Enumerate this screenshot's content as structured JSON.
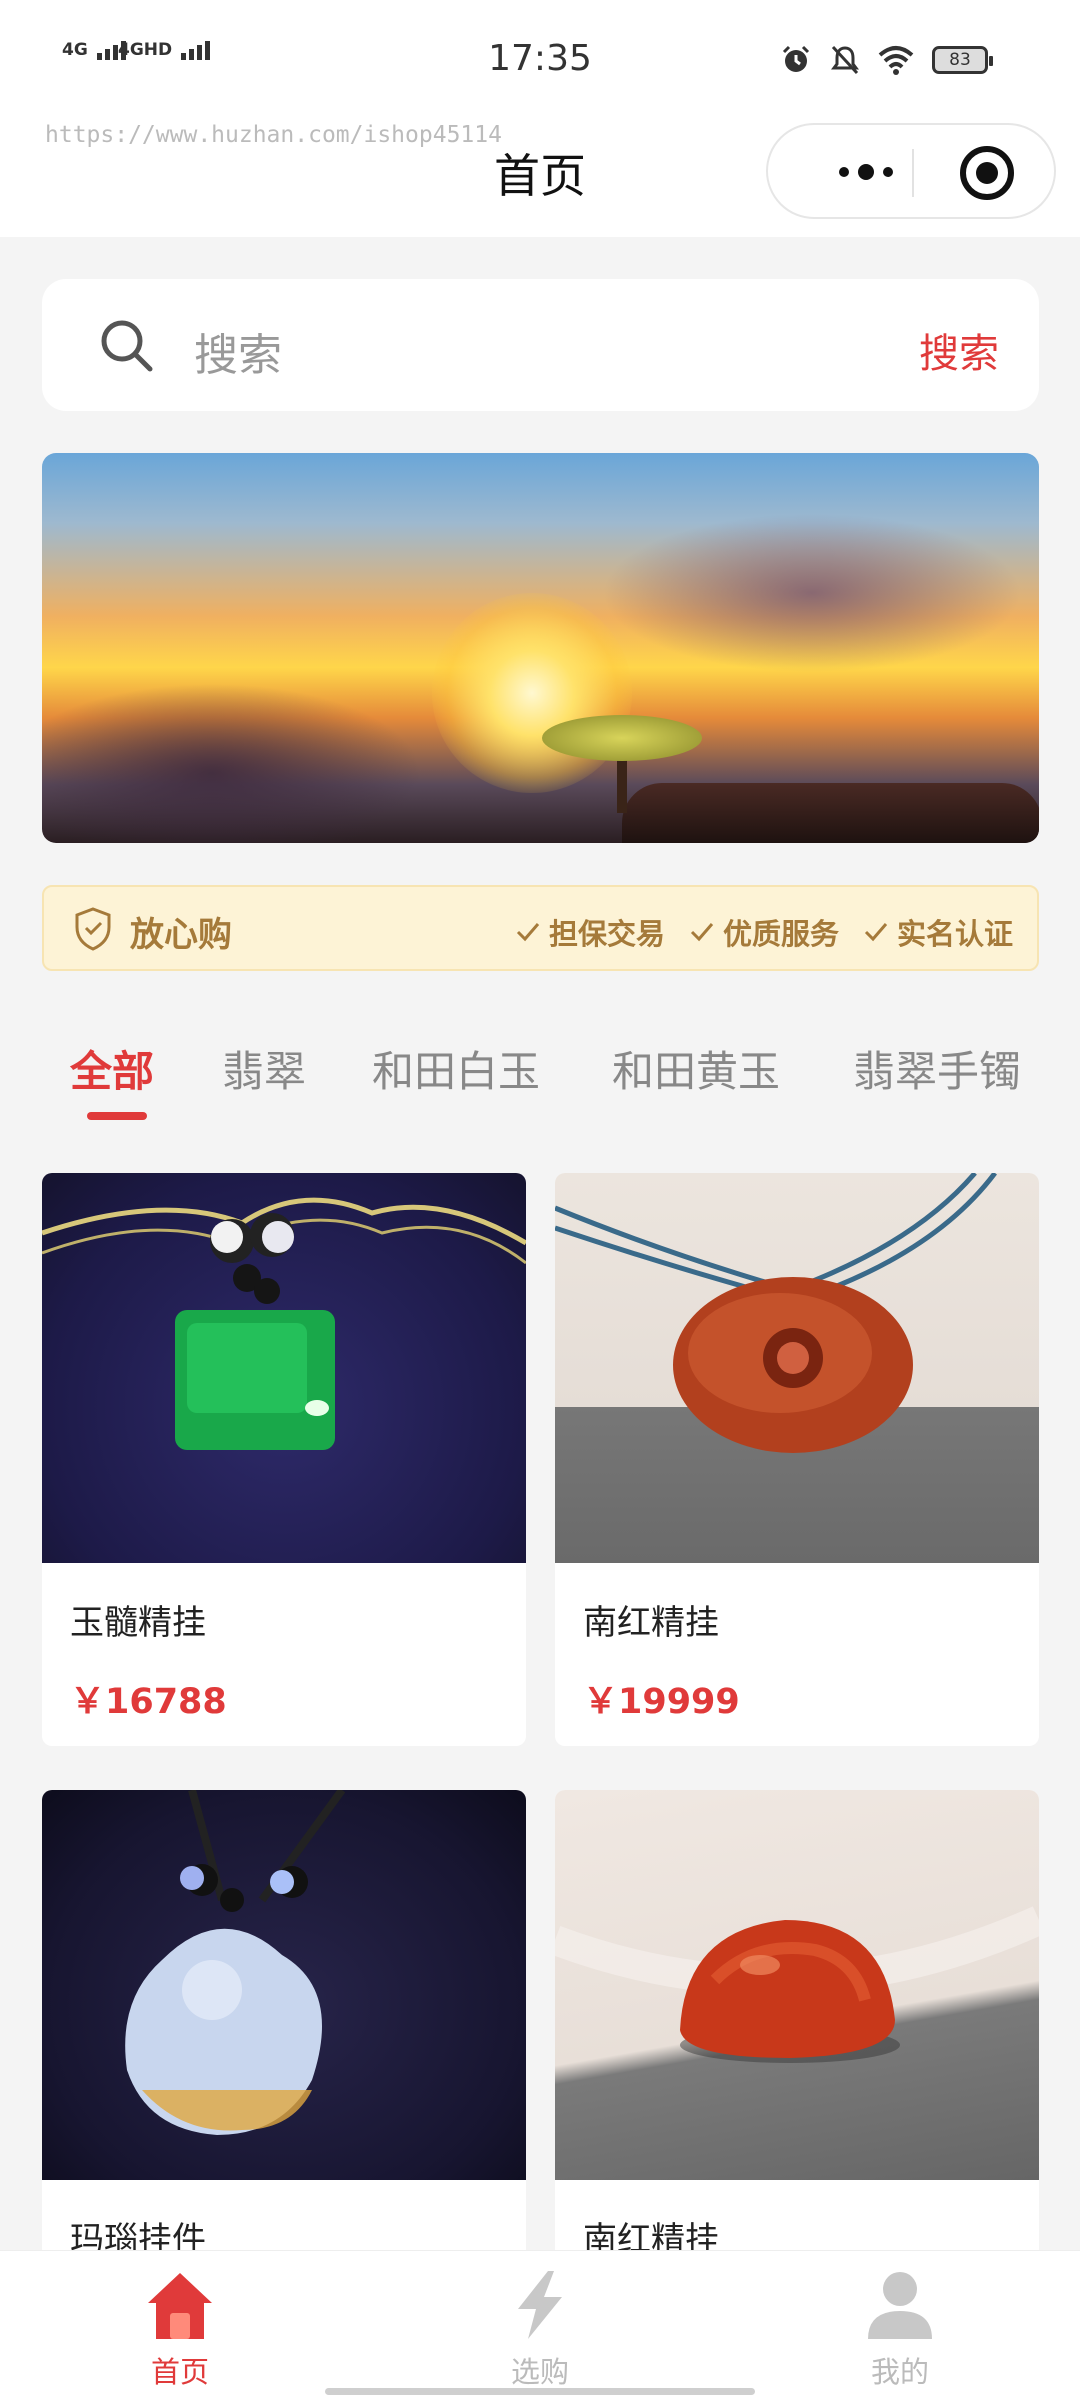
{
  "status_bar": {
    "time": "17:35",
    "signal1": "4G",
    "signal2": "4GHD",
    "battery": "83"
  },
  "nav": {
    "watermark": "https://www.huzhan.com/ishop45114",
    "title": "首页"
  },
  "search": {
    "placeholder": "搜索",
    "button": "搜索"
  },
  "assurance": {
    "title": "放心购",
    "features": [
      "担保交易",
      "优质服务",
      "实名认证"
    ]
  },
  "category_tabs": [
    "全部",
    "翡翠",
    "和田白玉",
    "和田黄玉",
    "翡翠手镯"
  ],
  "products": [
    {
      "name": "玉髓精挂",
      "price": "￥16788"
    },
    {
      "name": "南红精挂",
      "price": "￥19999"
    },
    {
      "name": "玛瑙挂件",
      "price": ""
    },
    {
      "name": "南红精挂",
      "price": ""
    }
  ],
  "tabbar": [
    {
      "label": "首页",
      "icon": "home-icon",
      "active": true
    },
    {
      "label": "选购",
      "icon": "lightning-icon",
      "active": false
    },
    {
      "label": "我的",
      "icon": "user-icon",
      "active": false
    }
  ],
  "colors": {
    "accent": "#e03a3a",
    "gold": "#a57a3a",
    "assurance_bg": "#fdf3d6"
  }
}
